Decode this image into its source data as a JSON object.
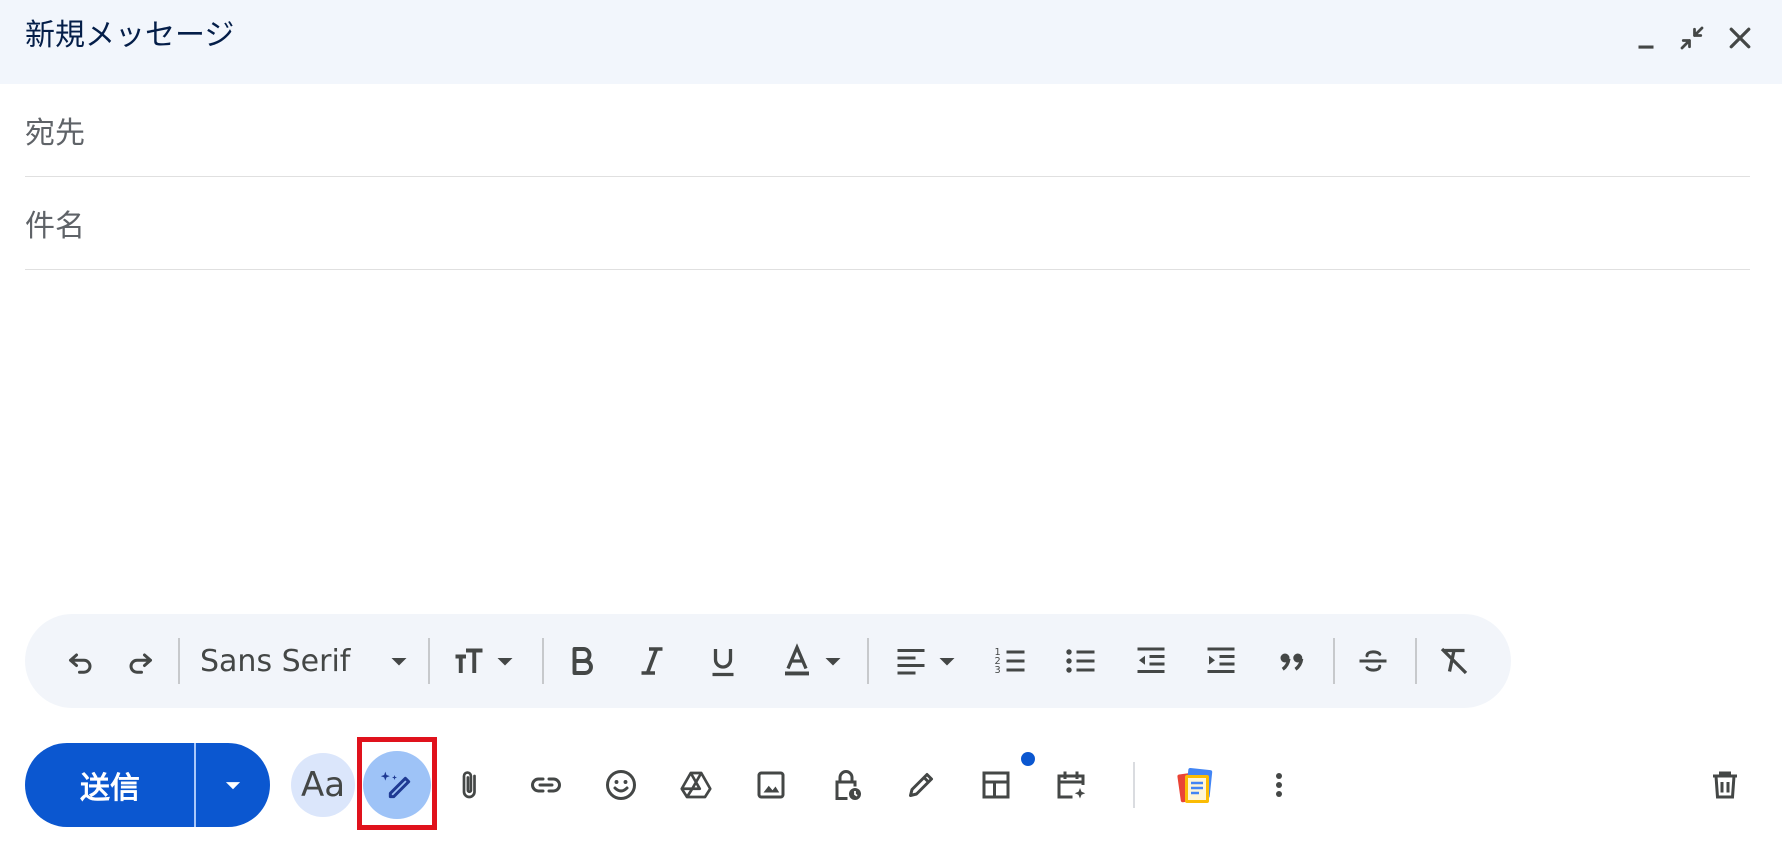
{
  "window": {
    "title": "新規メッセージ"
  },
  "fields": {
    "to_label": "宛先",
    "subject_label": "件名"
  },
  "format_toolbar": {
    "font_name": "Sans Serif"
  },
  "actions": {
    "send_label": "送信",
    "formatting_label": "Aa"
  },
  "colors": {
    "send_bg": "#0b57d0",
    "header_bg": "#f2f6fc",
    "toolbar_bg": "#f2f5fa",
    "highlight_border": "#e0121c"
  }
}
